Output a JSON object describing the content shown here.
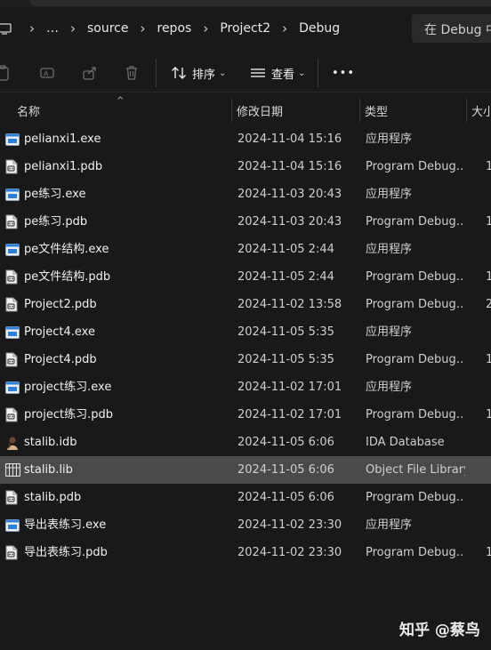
{
  "address": {
    "crumbs": [
      "…",
      "source",
      "repos",
      "Project2",
      "Debug"
    ],
    "search_placeholder": "在 Debug 中"
  },
  "toolbar": {
    "sort_label": "排序",
    "view_label": "查看",
    "more_label": "•••"
  },
  "columns": {
    "name": "名称",
    "date": "修改日期",
    "type": "类型",
    "size": "大小"
  },
  "files": [
    {
      "name": "pelianxi1.exe",
      "date": "2024-11-04 15:16",
      "type": "应用程序",
      "size": "",
      "icon": "exe-icon"
    },
    {
      "name": "pelianxi1.pdb",
      "date": "2024-11-04 15:16",
      "type": "Program Debug…",
      "size": "1",
      "icon": "pdb-icon"
    },
    {
      "name": "pe练习.exe",
      "date": "2024-11-03 20:43",
      "type": "应用程序",
      "size": "",
      "icon": "exe-icon"
    },
    {
      "name": "pe练习.pdb",
      "date": "2024-11-03 20:43",
      "type": "Program Debug…",
      "size": "1",
      "icon": "pdb-icon"
    },
    {
      "name": "pe文件结构.exe",
      "date": "2024-11-05 2:44",
      "type": "应用程序",
      "size": "",
      "icon": "exe-icon"
    },
    {
      "name": "pe文件结构.pdb",
      "date": "2024-11-05 2:44",
      "type": "Program Debug…",
      "size": "1",
      "icon": "pdb-icon"
    },
    {
      "name": "Project2.pdb",
      "date": "2024-11-02 13:58",
      "type": "Program Debug…",
      "size": "2",
      "icon": "pdb-icon"
    },
    {
      "name": "Project4.exe",
      "date": "2024-11-05 5:35",
      "type": "应用程序",
      "size": "",
      "icon": "exe-icon"
    },
    {
      "name": "Project4.pdb",
      "date": "2024-11-05 5:35",
      "type": "Program Debug…",
      "size": "1",
      "icon": "pdb-icon"
    },
    {
      "name": "project练习.exe",
      "date": "2024-11-02 17:01",
      "type": "应用程序",
      "size": "",
      "icon": "exe-icon"
    },
    {
      "name": "project练习.pdb",
      "date": "2024-11-02 17:01",
      "type": "Program Debug…",
      "size": "1",
      "icon": "pdb-icon"
    },
    {
      "name": "stalib.idb",
      "date": "2024-11-05 6:06",
      "type": "IDA Database",
      "size": "",
      "icon": "ida-icon"
    },
    {
      "name": "stalib.lib",
      "date": "2024-11-05 6:06",
      "type": "Object File Library",
      "size": "",
      "icon": "lib-icon",
      "selected": true
    },
    {
      "name": "stalib.pdb",
      "date": "2024-11-05 6:06",
      "type": "Program Debug…",
      "size": "",
      "icon": "pdb-icon"
    },
    {
      "name": "导出表练习.exe",
      "date": "2024-11-02 23:30",
      "type": "应用程序",
      "size": "",
      "icon": "exe-icon"
    },
    {
      "name": "导出表练习.pdb",
      "date": "2024-11-02 23:30",
      "type": "Program Debug…",
      "size": "1",
      "icon": "pdb-icon"
    }
  ],
  "watermark": "知乎 @蔡鸟",
  "colors": {
    "background": "#191919",
    "selected_row": "#4a4a4a",
    "exe_icon_blue": "#2f7fd8"
  }
}
